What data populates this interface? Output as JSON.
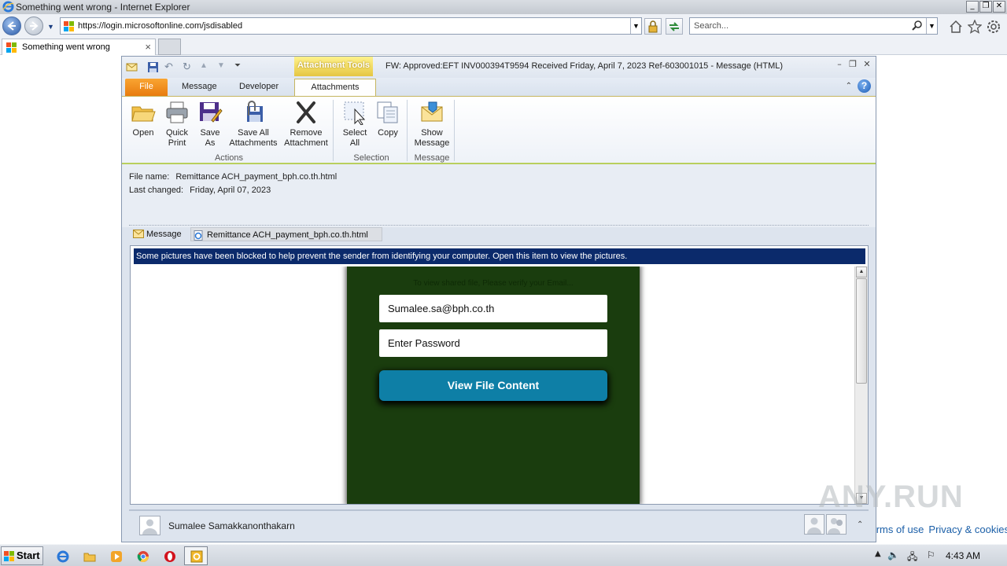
{
  "browser": {
    "window_title": "Something went wrong - Internet Explorer",
    "address_url": "https://login.microsoftonline.com/jsdisabled",
    "search_placeholder": "Search...",
    "tab_title": "Something went wrong",
    "footer_links": [
      "Terms of use",
      "Privacy & cookies"
    ]
  },
  "outlook": {
    "contextual_tab_group": "Attachment Tools",
    "window_title": "FW: Approved:EFT INV000394T9594 Received Friday, April 7, 2023 Ref-603001015  -  Message (HTML)",
    "ribbon_tabs": {
      "file": "File",
      "message": "Message",
      "developer": "Developer",
      "attachments": "Attachments"
    },
    "ribbon_buttons": {
      "open": "Open",
      "quick_print_1": "Quick",
      "quick_print_2": "Print",
      "save_as_1": "Save",
      "save_as_2": "As",
      "save_all_1": "Save All",
      "save_all_2": "Attachments",
      "remove_1": "Remove",
      "remove_2": "Attachment",
      "select_all_1": "Select",
      "select_all_2": "All",
      "copy": "Copy",
      "show_msg_1": "Show",
      "show_msg_2": "Message"
    },
    "ribbon_groups": {
      "actions": "Actions",
      "selection": "Selection",
      "message": "Message"
    },
    "file_info": {
      "file_name_label": "File name:",
      "file_name": "Remittance ACH_payment_bph.co.th.html",
      "last_changed_label": "Last changed:",
      "last_changed": "Friday, April 07, 2023"
    },
    "attachment_strip": {
      "message": "Message",
      "attachment": "Remittance ACH_payment_bph.co.th.html"
    },
    "infobar": "Some pictures have been blocked to help prevent the sender from identifying your computer. Open this item to view the pictures.",
    "preview": {
      "notice": "To view shared file, Please verify your Email...",
      "email_value": "Sumalee.sa@bph.co.th",
      "password_placeholder": "Enter Password",
      "button_label": "View File Content"
    },
    "people_pane": {
      "name": "Sumalee Samakkanonthakarn"
    }
  },
  "watermark": "ANY.RUN",
  "taskbar": {
    "start_label": "Start",
    "clock": "4:43 AM"
  },
  "colors": {
    "phish_bg": "#1a3d0e",
    "button_bg": "#0e7fa6",
    "infobar_bg": "#0b2a6b",
    "file_tab": "#f39422",
    "contextual_tab": "#f1d650"
  }
}
